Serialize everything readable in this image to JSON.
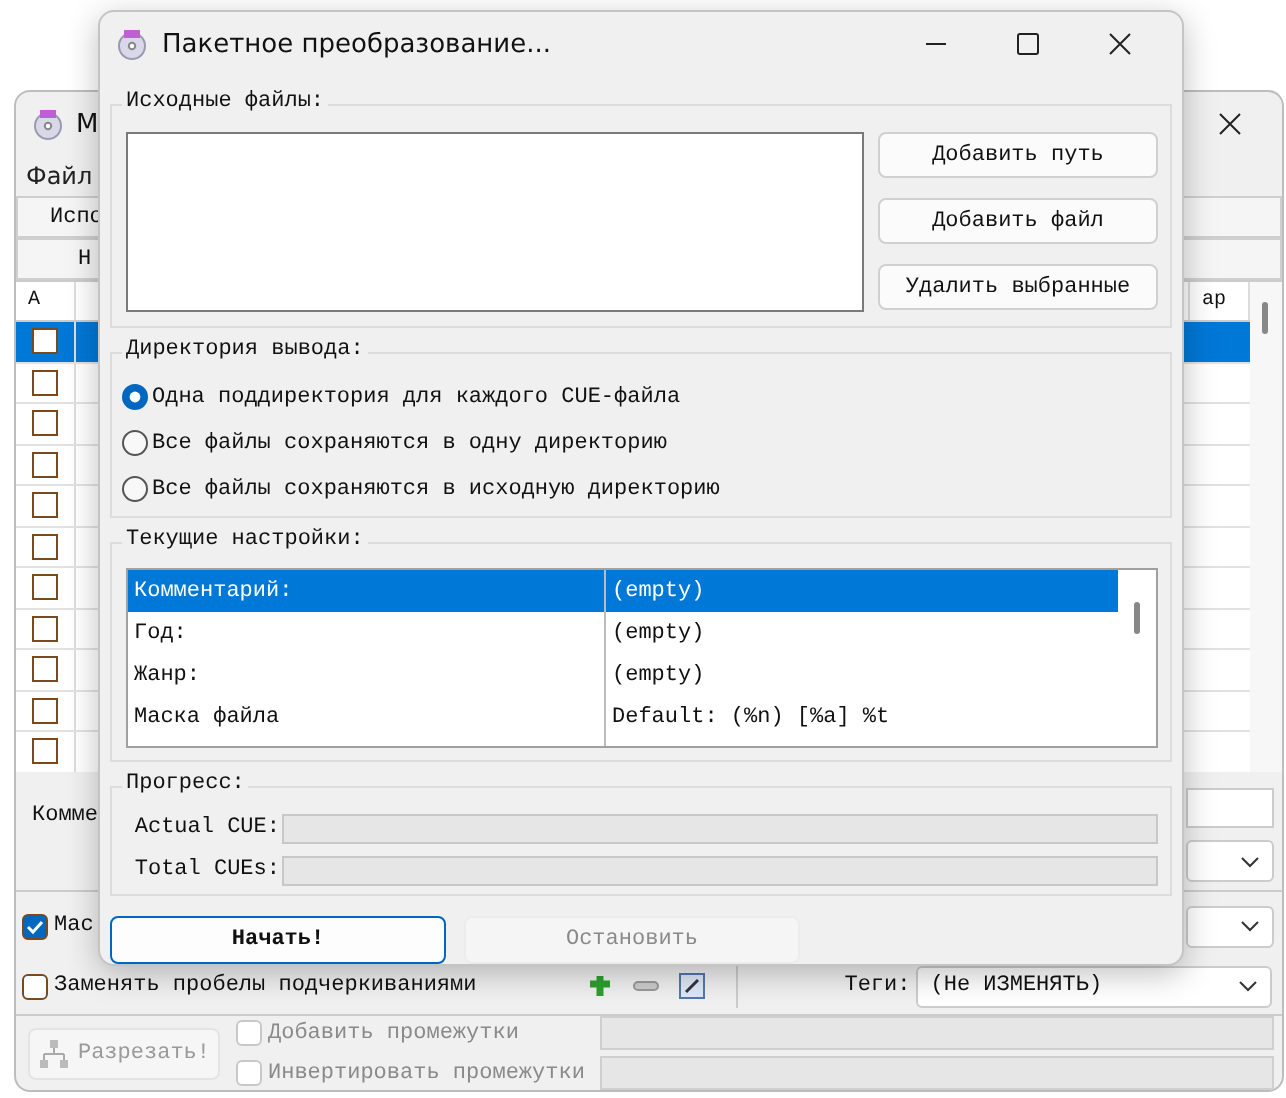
{
  "main_window": {
    "title": "М",
    "menu": [
      {
        "label": "Файл"
      }
    ],
    "header_rows": [
      "Испо",
      "Н"
    ],
    "table": {
      "columns": [
        "А",
        "ар"
      ],
      "rows": [
        {
          "selected": true,
          "checked": false
        },
        {
          "selected": false,
          "checked": false
        },
        {
          "selected": false,
          "checked": false
        },
        {
          "selected": false,
          "checked": false
        },
        {
          "selected": false,
          "checked": false
        },
        {
          "selected": false,
          "checked": false
        },
        {
          "selected": false,
          "checked": false
        },
        {
          "selected": false,
          "checked": false
        },
        {
          "selected": false,
          "checked": false
        },
        {
          "selected": false,
          "checked": false
        },
        {
          "selected": false,
          "checked": false
        }
      ]
    },
    "comment_label": "Комме",
    "options": [
      {
        "label": "Мас",
        "checked": true
      },
      {
        "label": "Заменять пробелы подчеркиваниями",
        "checked": false
      }
    ],
    "tags": {
      "label": "Теги:",
      "value": "(Не ИЗМЕНЯТЬ)"
    },
    "split_button": {
      "label": "Разрезать!",
      "disabled": true
    },
    "gap_options": [
      {
        "label": "Добавить промежутки",
        "checked": false,
        "disabled": true
      },
      {
        "label": "Инвертировать промежутки",
        "checked": false,
        "disabled": true
      }
    ]
  },
  "dialog": {
    "title": "Пакетное преобразование...",
    "source_files": {
      "label": "Исходные файлы:",
      "buttons": [
        "Добавить путь",
        "Добавить файл",
        "Удалить выбранные"
      ]
    },
    "output_dir": {
      "label": "Директория вывода:",
      "options": [
        {
          "label": "Одна поддиректория для каждого CUE-файла",
          "selected": true
        },
        {
          "label": "Все файлы сохраняются в одну директорию",
          "selected": false
        },
        {
          "label": "Все файлы сохраняются в исходную директорию",
          "selected": false
        }
      ]
    },
    "settings": {
      "label": "Текущие настройки:",
      "rows": [
        {
          "name": "Комментарий:",
          "value": "(empty)",
          "selected": true
        },
        {
          "name": "Год:",
          "value": "(empty)",
          "selected": false
        },
        {
          "name": "Жанр:",
          "value": "(empty)",
          "selected": false
        },
        {
          "name": "Маска файла",
          "value": "Default: (%n) [%a] %t",
          "selected": false
        }
      ]
    },
    "progress": {
      "label": "Прогресс:",
      "bars": [
        {
          "label": "Actual CUE:",
          "level": 0
        },
        {
          "label": "Total CUEs:",
          "level": 0
        }
      ]
    },
    "buttons": [
      {
        "label": "Начать!",
        "disabled": false
      },
      {
        "label": "Остановить",
        "disabled": true
      }
    ]
  }
}
